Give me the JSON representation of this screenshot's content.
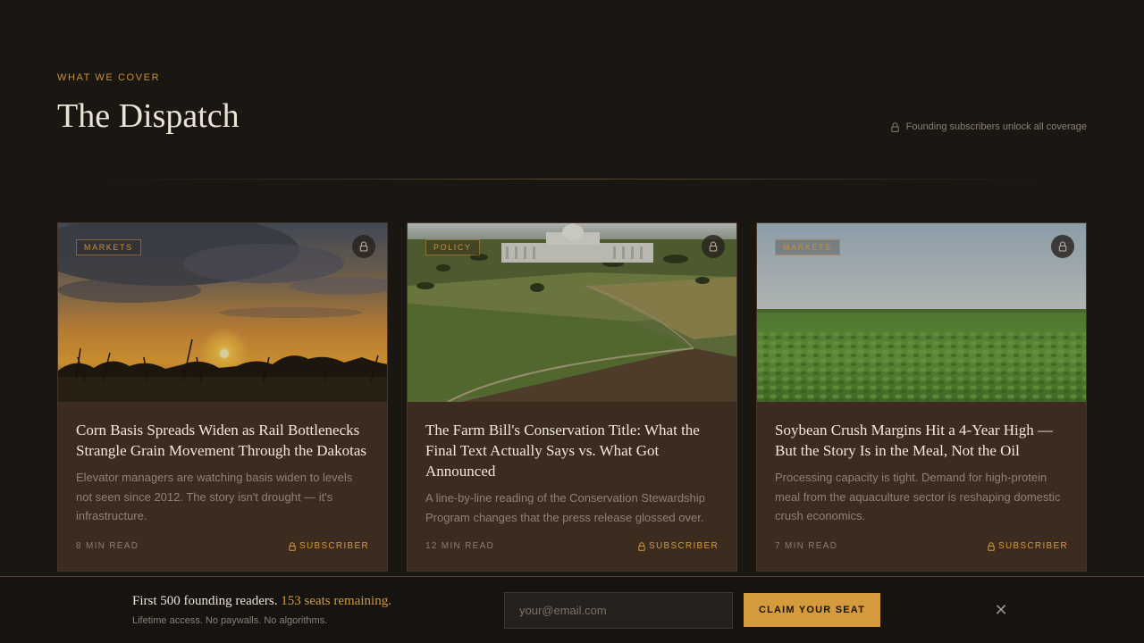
{
  "header": {
    "eyebrow": "WHAT WE COVER",
    "title": "The Dispatch",
    "lock_note": "Founding subscribers unlock all coverage"
  },
  "cards": [
    {
      "tag": "MARKETS",
      "image": "sunset-cornfield",
      "title": "Corn Basis Spreads Widen as Rail Bottlenecks Strangle Grain Movement Through the Dakotas",
      "description": "Elevator managers are watching basis widen to levels not seen since 2012. The story isn't drought — it's infrastructure.",
      "read_time": "8 MIN READ",
      "access": "SUBSCRIBER"
    },
    {
      "tag": "POLICY",
      "image": "capitol-farmland-aerial",
      "title": "The Farm Bill's Conservation Title: What the Final Text Actually Says vs. What Got Announced",
      "description": "A line-by-line reading of the Conservation Stewardship Program changes that the press release glossed over.",
      "read_time": "12 MIN READ",
      "access": "SUBSCRIBER"
    },
    {
      "tag": "MARKETS",
      "image": "soybean-field",
      "title": "Soybean Crush Margins Hit a 4-Year High — But the Story Is in the Meal, Not the Oil",
      "description": "Processing capacity is tight. Demand for high-protein meal from the aquaculture sector is reshaping domestic crush economics.",
      "read_time": "7 MIN READ",
      "access": "SUBSCRIBER"
    }
  ],
  "signup": {
    "headline": "First 500 founding readers.",
    "highlight": "153 seats remaining.",
    "subtext": "Lifetime access. No paywalls. No algorithms.",
    "email_placeholder": "your@email.com",
    "cta_label": "CLAIM YOUR SEAT",
    "close_label": "✕"
  },
  "colors": {
    "accent": "#d49a3c",
    "background": "#1a1612",
    "card": "#3c2b1f"
  }
}
